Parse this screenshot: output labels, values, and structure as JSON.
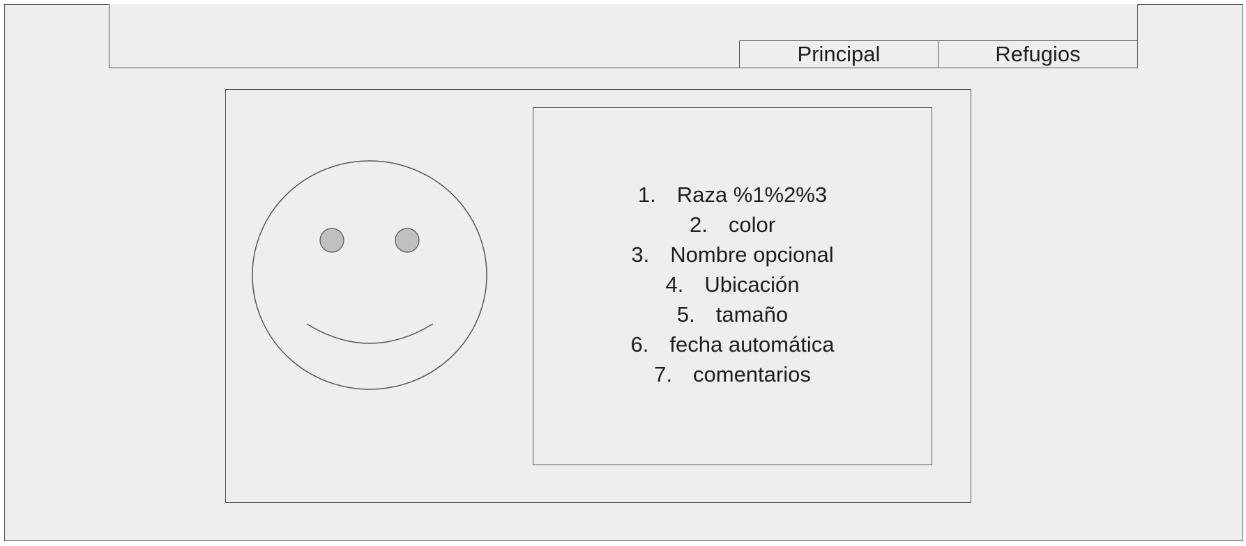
{
  "nav": {
    "items": [
      {
        "label": "Principal"
      },
      {
        "label": "Refugios"
      }
    ]
  },
  "avatar": {
    "icon": "smiley-face-icon"
  },
  "fields": [
    {
      "number": "1.",
      "label": "Raza %1%2%3"
    },
    {
      "number": "2.",
      "label": "color"
    },
    {
      "number": "3.",
      "label": "Nombre opcional"
    },
    {
      "number": "4.",
      "label": "Ubicación"
    },
    {
      "number": "5.",
      "label": "tamaño"
    },
    {
      "number": "6.",
      "label": "fecha automática"
    },
    {
      "number": "7.",
      "label": "comentarios"
    }
  ],
  "colors": {
    "background": "#eeeeee",
    "border": "#555555",
    "eye_fill": "#c0c0c0"
  }
}
